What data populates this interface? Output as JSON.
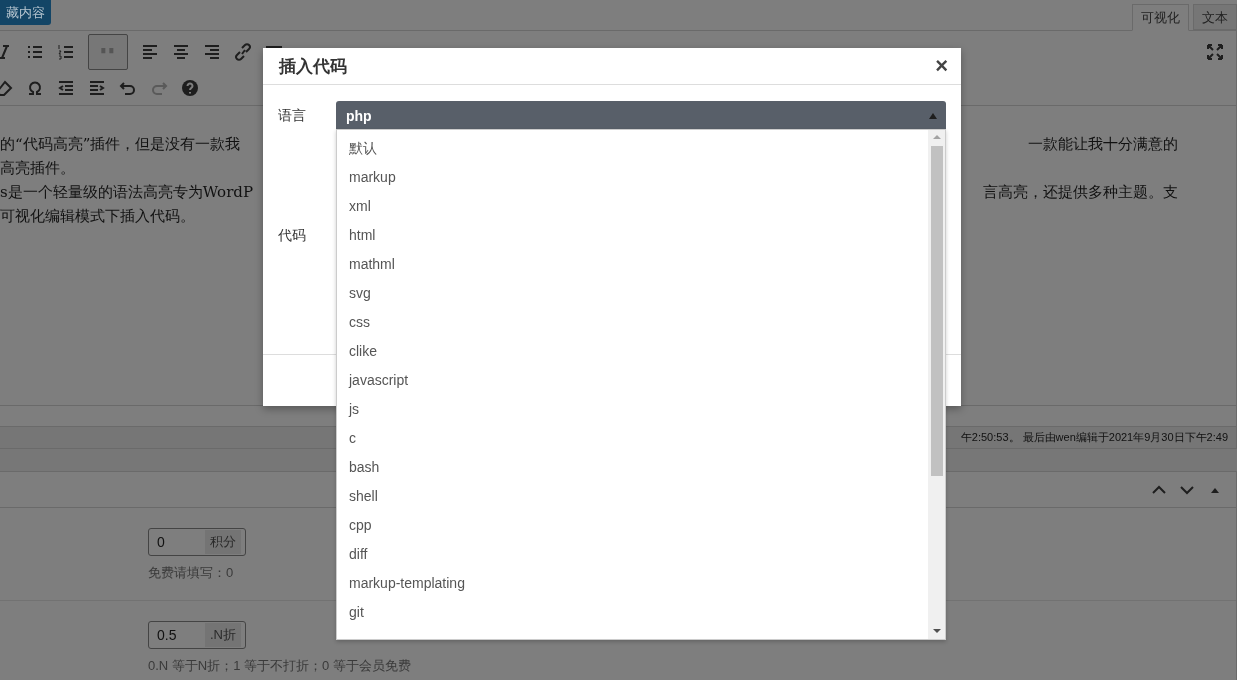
{
  "top_button": {
    "label": "藏内容"
  },
  "editor_tabs": [
    {
      "label": "可视化",
      "selected": true
    },
    {
      "label": "文本",
      "selected": false
    }
  ],
  "content_lines": [
    {
      "left": "的“代码高亮”插件，但是没有一款我",
      "right": "一款能让我十分满意的"
    },
    {
      "left": "高亮插件。"
    },
    {
      "left": "s是一个轻量级的语法高亮专为WordP",
      "right": "言高亮，还提供多种主题。支"
    },
    {
      "left": "可视化编辑模式下插入代码。"
    }
  ],
  "status_bar": {
    "text": "午2:50:53。 最后由wen编辑于2021年9月30日下午2:49"
  },
  "fields": [
    {
      "value": "0",
      "addon": "积分",
      "help": "免费请填写：0"
    },
    {
      "value": "0.5",
      "addon": ".N折",
      "help": "0.N 等于N折；1 等于不打折；0 等于会员免费"
    }
  ],
  "dialog": {
    "title": "插入代码",
    "close": "×",
    "language_label": "语言",
    "code_label": "代码",
    "language_select": {
      "value": "php",
      "expanded": true
    },
    "options": [
      {
        "label": "默认",
        "selected": false
      },
      {
        "label": "markup",
        "selected": false
      },
      {
        "label": "xml",
        "selected": false
      },
      {
        "label": "html",
        "selected": false
      },
      {
        "label": "mathml",
        "selected": false
      },
      {
        "label": "svg",
        "selected": false
      },
      {
        "label": "css",
        "selected": false
      },
      {
        "label": "clike",
        "selected": false
      },
      {
        "label": "javascript",
        "selected": false
      },
      {
        "label": "js",
        "selected": false
      },
      {
        "label": "c",
        "selected": false
      },
      {
        "label": "bash",
        "selected": false
      },
      {
        "label": "shell",
        "selected": false
      },
      {
        "label": "cpp",
        "selected": false
      },
      {
        "label": "diff",
        "selected": false
      },
      {
        "label": "markup-templating",
        "selected": false
      },
      {
        "label": "git",
        "selected": false
      }
    ]
  }
}
